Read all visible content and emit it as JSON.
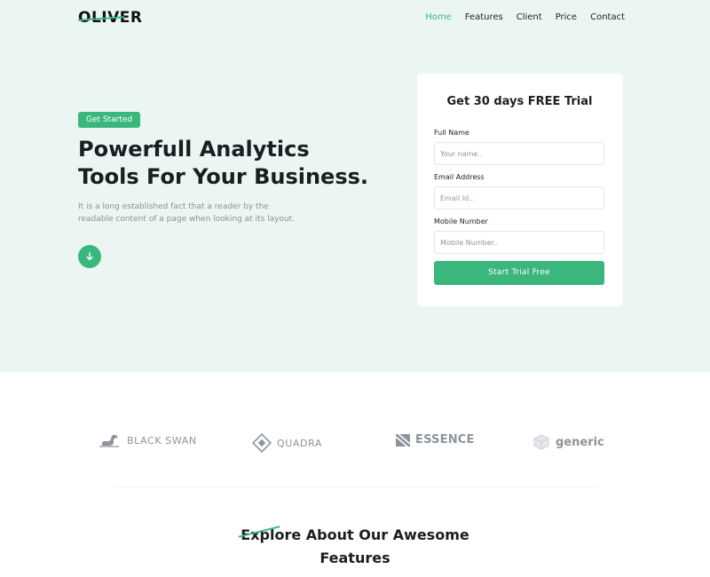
{
  "header": {
    "logo": "OLIVER",
    "nav": [
      "Home",
      "Features",
      "Client",
      "Price",
      "Contact"
    ],
    "active_nav": "Home"
  },
  "hero": {
    "badge": "Get Started",
    "headline_line1": "Powerfull Analytics",
    "headline_line2": "Tools For Your Business.",
    "lead": "It is a long established fact that a reader by the readable content of a page when looking at its layout.",
    "scroll_icon": "arrow-down-icon"
  },
  "trial_form": {
    "title": "Get 30 days FREE Trial",
    "fields": [
      {
        "label": "Full Name",
        "placeholder": "Your name..",
        "value": ""
      },
      {
        "label": "Email Address",
        "placeholder": "Email Id..",
        "value": ""
      },
      {
        "label": "Mobile Number",
        "placeholder": "Mobile Number..",
        "value": ""
      }
    ],
    "submit_label": "Start Trial Free"
  },
  "brands": [
    {
      "name": "BLACK SWAN",
      "icon": "swan-icon"
    },
    {
      "name": "QUADRA",
      "icon": "diamond-icon"
    },
    {
      "name": "ESSENCE",
      "icon": "square-stripe-icon"
    },
    {
      "name": "generic",
      "icon": "cube-icon"
    }
  ],
  "features_section": {
    "title_line1": "Explore About Our Awesome",
    "title_line2": "Features"
  },
  "colors": {
    "accent": "#3bb77e",
    "hero_background": "#ebf6f2",
    "heading": "#1a1d21",
    "muted_text": "#8a9196"
  }
}
